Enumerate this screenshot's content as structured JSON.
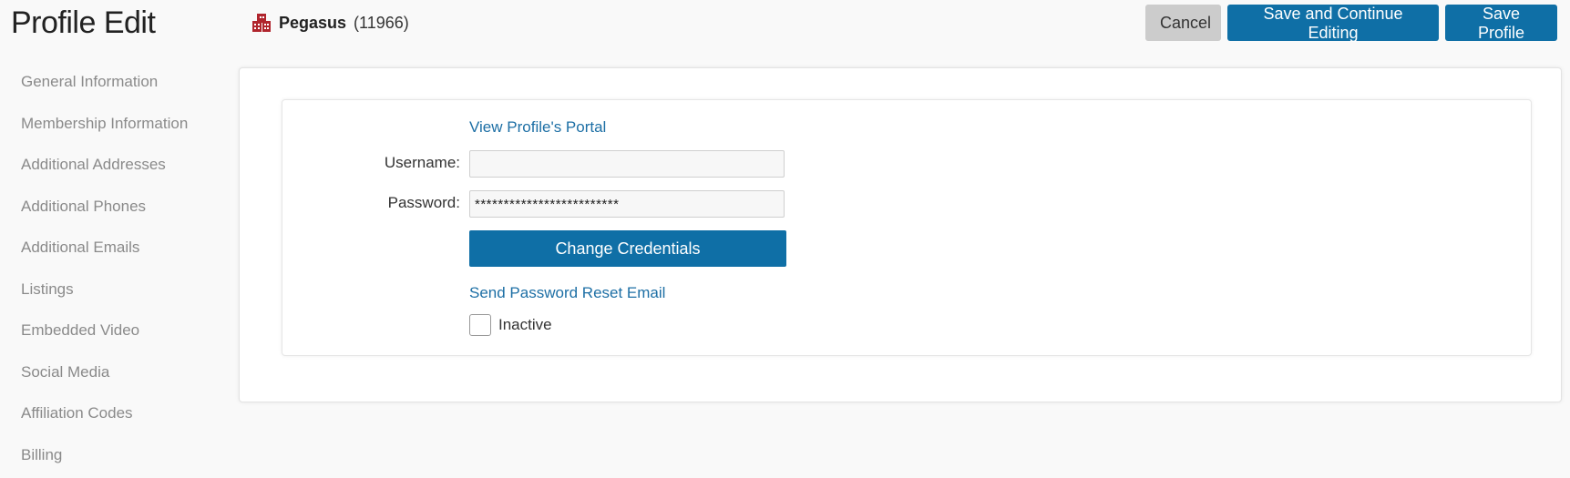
{
  "header": {
    "title": "Profile Edit",
    "org_name": "Pegasus",
    "org_id": "(11966)",
    "org_icon": "building-icon"
  },
  "actions": {
    "cancel_label": "Cancel",
    "save_continue_label": "Save and Continue Editing",
    "save_label": "Save Profile"
  },
  "sidebar": {
    "items": [
      {
        "label": "General Information"
      },
      {
        "label": "Membership Information"
      },
      {
        "label": "Additional Addresses"
      },
      {
        "label": "Additional Phones"
      },
      {
        "label": "Additional Emails"
      },
      {
        "label": "Listings"
      },
      {
        "label": "Embedded Video"
      },
      {
        "label": "Social Media"
      },
      {
        "label": "Affiliation Codes"
      },
      {
        "label": "Billing"
      }
    ]
  },
  "credentials": {
    "portal_link": "View Profile's Portal",
    "username_label": "Username:",
    "username_value": "",
    "password_label": "Password:",
    "password_value": "*************************",
    "change_button": "Change Credentials",
    "reset_link": "Send Password Reset Email",
    "inactive_label": "Inactive",
    "inactive_checked": false
  },
  "colors": {
    "primary": "#0f6fa6",
    "link": "#1d6fa5",
    "cancel_bg": "#cccccc",
    "sidebar_text": "#8a8a8a",
    "org_icon": "#b0252d"
  }
}
